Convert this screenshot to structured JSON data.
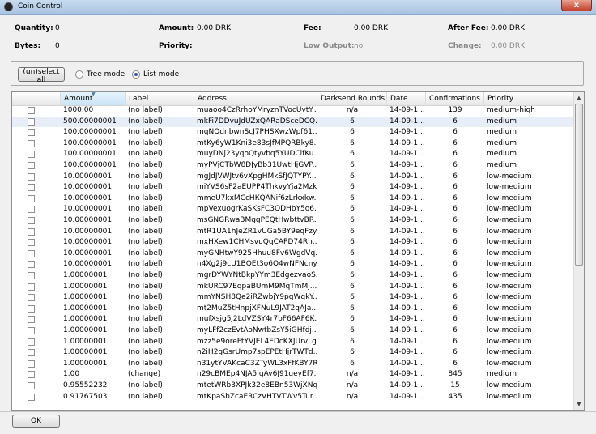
{
  "window": {
    "title": "Coin Control",
    "close_label": "x"
  },
  "summary": {
    "quantity_label": "Quantity:",
    "quantity_value": "0",
    "bytes_label": "Bytes:",
    "bytes_value": "0",
    "amount_label": "Amount:",
    "amount_value": "0.00 DRK",
    "priority_label": "Priority:",
    "priority_value": "",
    "fee_label": "Fee:",
    "fee_value": "0.00 DRK",
    "low_output_label": "Low Output:",
    "low_output_value": "no",
    "after_fee_label": "After Fee:",
    "after_fee_value": "0.00 DRK",
    "change_label": "Change:",
    "change_value": "0.00 DRK"
  },
  "modes": {
    "select_all_label": "(un)select all",
    "tree_mode_label": "Tree mode",
    "list_mode_label": "List mode",
    "selected": "list"
  },
  "table": {
    "headers": [
      "Amount",
      "Label",
      "Address",
      "Darksend Rounds",
      "Date",
      "Confirmations",
      "Priority"
    ],
    "rows": [
      [
        "1000.00",
        "(no label)",
        "muaoo4CzRrhoYMryznTVocUvtY...",
        "n/a",
        "14-09-1...",
        "139",
        "medium-high"
      ],
      [
        "500.00000001",
        "(no label)",
        "mkFi7DDvuJdUZxQARaDSceDCQ...",
        "6",
        "14-09-1...",
        "6",
        "medium"
      ],
      [
        "100.00000001",
        "(no label)",
        "mqNQdnbwnScJ7PHSXwzWpf61...",
        "6",
        "14-09-1...",
        "6",
        "medium"
      ],
      [
        "100.00000001",
        "(no label)",
        "mtKy6yW1Kni3e83sJfMPQRBky8...",
        "6",
        "14-09-1...",
        "6",
        "medium"
      ],
      [
        "100.00000001",
        "(no label)",
        "muyDNj23yqoQtyvbq5YUDCifKu...",
        "6",
        "14-09-1...",
        "6",
        "medium"
      ],
      [
        "100.00000001",
        "(no label)",
        "myPVjCTbW8DJyBb31UwtHjGVP...",
        "6",
        "14-09-1...",
        "6",
        "medium"
      ],
      [
        "10.00000001",
        "(no label)",
        "mgJdJVWJtv6vXpgHMkSfJQTYPY...",
        "6",
        "14-09-1...",
        "6",
        "low-medium"
      ],
      [
        "10.00000001",
        "(no label)",
        "miYVS6sF2aEUPP4ThkvyYja2Mzk...",
        "6",
        "14-09-1...",
        "6",
        "low-medium"
      ],
      [
        "10.00000001",
        "(no label)",
        "mmeU7kxMCcHKQANif6zLrkxkw...",
        "6",
        "14-09-1...",
        "6",
        "low-medium"
      ],
      [
        "10.00000001",
        "(no label)",
        "mpVexuogrKaSKsFC3QDHbY5o6...",
        "6",
        "14-09-1...",
        "6",
        "low-medium"
      ],
      [
        "10.00000001",
        "(no label)",
        "msGNGRwaBMggPEQtHwbttvBR...",
        "6",
        "14-09-1...",
        "6",
        "low-medium"
      ],
      [
        "10.00000001",
        "(no label)",
        "mtR1UA1hJeZR1vUGa5BY9eqFzy...",
        "6",
        "14-09-1...",
        "6",
        "low-medium"
      ],
      [
        "10.00000001",
        "(no label)",
        "mxHXew1CHMsvuQqCAPD74Rh...",
        "6",
        "14-09-1...",
        "6",
        "low-medium"
      ],
      [
        "10.00000001",
        "(no label)",
        "myGNHtwY925Hhuu8Fv6WgdVq...",
        "6",
        "14-09-1...",
        "6",
        "low-medium"
      ],
      [
        "10.00000001",
        "(no label)",
        "n4Xg2j9cU1BQEt3o6Q4wNFNcny...",
        "6",
        "14-09-1...",
        "6",
        "low-medium"
      ],
      [
        "1.00000001",
        "(no label)",
        "mgrDYWYNtBkpYYm3EdgezvaoS...",
        "6",
        "14-09-1...",
        "6",
        "low-medium"
      ],
      [
        "1.00000001",
        "(no label)",
        "mkURC97EqpaBUmM9MqTmMj...",
        "6",
        "14-09-1...",
        "6",
        "low-medium"
      ],
      [
        "1.00000001",
        "(no label)",
        "mmYNSH8Qe2iRZwbjY9pqWqkY...",
        "6",
        "14-09-1...",
        "6",
        "low-medium"
      ],
      [
        "1.00000001",
        "(no label)",
        "mt2MuZ5tHnpjXFNuL9JAT2qAJa...",
        "6",
        "14-09-1...",
        "6",
        "low-medium"
      ],
      [
        "1.00000001",
        "(no label)",
        "mufXsjg5j2LdVZSY4r7bF66AF6K...",
        "6",
        "14-09-1...",
        "6",
        "low-medium"
      ],
      [
        "1.00000001",
        "(no label)",
        "myLFf2czEvtAoNwtbZsY5iGHfdj...",
        "6",
        "14-09-1...",
        "6",
        "low-medium"
      ],
      [
        "1.00000001",
        "(no label)",
        "mzz5e9oreFtYVJEL4EDcKXJUrvLg...",
        "6",
        "14-09-1...",
        "6",
        "low-medium"
      ],
      [
        "1.00000001",
        "(no label)",
        "n2iH2gGsrUmp7spEPEtHjrTWTd...",
        "6",
        "14-09-1...",
        "6",
        "low-medium"
      ],
      [
        "1.00000001",
        "(no label)",
        "n31ytYVAKcaC3ZTyWL3xFfKBY7R...",
        "6",
        "14-09-1...",
        "6",
        "low-medium"
      ],
      [
        "1.00",
        "(change)",
        "n29cBMEp4NJA5JgAv6J91geyEf7...",
        "n/a",
        "14-09-1...",
        "845",
        "medium"
      ],
      [
        "0.95552232",
        "(no label)",
        "mtetWRb3XPJk32e8EBn53WjXNq...",
        "n/a",
        "14-09-1...",
        "15",
        "low-medium"
      ],
      [
        "0.91767503",
        "(no label)",
        "mtKpaSbZcaERCzVHTVTWv5Tur...",
        "n/a",
        "14-09-1...",
        "435",
        "low-medium"
      ]
    ]
  },
  "footer": {
    "ok_label": "OK"
  }
}
